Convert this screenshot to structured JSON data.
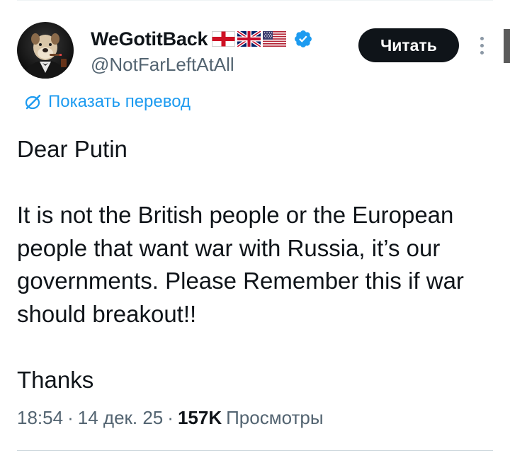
{
  "author": {
    "display_name": "WeGotitBack",
    "handle": "@NotFarLeftAtAll",
    "flags": [
      "england-flag-icon",
      "uk-flag-icon",
      "usa-flag-icon"
    ],
    "verified_color": "#1d9bf0"
  },
  "actions": {
    "follow_label": "Читать"
  },
  "translate": {
    "label": "Показать перевод",
    "color": "#1d9bf0"
  },
  "tweet": {
    "paragraphs": [
      "Dear Putin",
      "It is not the British people or the European people that want war with Russia, it’s our governments. Please Remember this if war should breakout!!",
      "Thanks"
    ]
  },
  "meta": {
    "time": "18:54",
    "separator": "·",
    "date": "14 дек. 25",
    "views_count": "157K",
    "views_label": "Просмотры"
  },
  "colors": {
    "text_primary": "#0f1419",
    "text_secondary": "#536471",
    "button_bg": "#0f1419",
    "link": "#1d9bf0"
  }
}
